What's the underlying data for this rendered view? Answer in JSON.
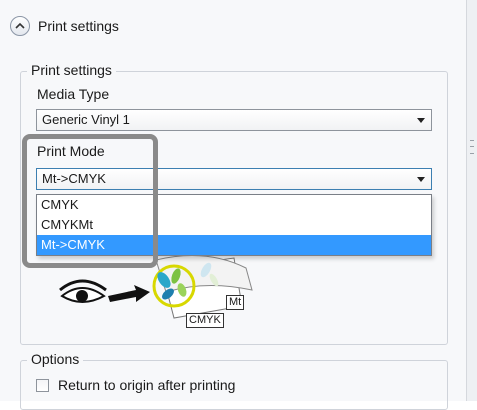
{
  "header": {
    "title": "Print settings",
    "toggle_icon": "chevron-up-icon"
  },
  "print_settings_group": {
    "legend": "Print settings",
    "media_type": {
      "label": "Media Type",
      "value": "Generic Vinyl 1"
    },
    "print_mode": {
      "label": "Print Mode",
      "value": "Mt->CMYK",
      "options": [
        "CMYK",
        "CMYKMt",
        "Mt->CMYK"
      ],
      "selected_index": 2
    },
    "illustration": {
      "tag_mt": "Mt",
      "tag_cmyk": "CMYK"
    }
  },
  "options_group": {
    "legend": "Options",
    "return_to_origin": {
      "label": "Return to origin after printing",
      "checked": false
    }
  },
  "colors": {
    "selection": "#3399ff",
    "highlight_frame": "#8a8a8a"
  }
}
